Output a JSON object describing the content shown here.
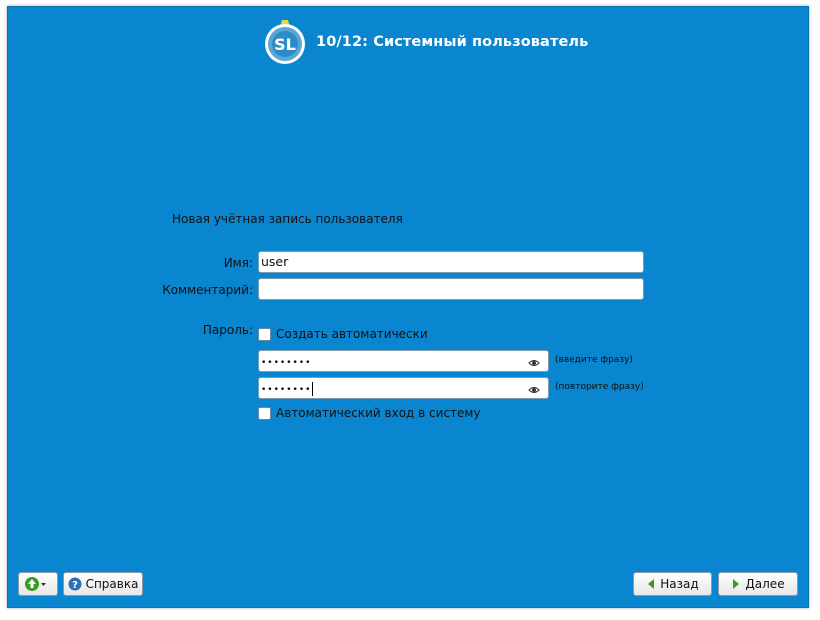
{
  "header": {
    "logo_text": "SL",
    "title": "10/12: Системный пользователь"
  },
  "form": {
    "section_title": "Новая учётная запись пользователя",
    "name_label": "Имя:",
    "name_value": "user",
    "comment_label": "Комментарий:",
    "comment_value": "",
    "password_label": "Пароль:",
    "auto_create_label": "Создать автоматически",
    "auto_create_checked": false,
    "password_value": "••••••••",
    "password_hint": "(введите фразу)",
    "password_repeat_value": "••••••••",
    "password_repeat_hint": "(повторите фразу)",
    "autologin_label": "Автоматический вход в систему",
    "autologin_checked": false
  },
  "footer": {
    "help_label": "Справка",
    "back_label": "Назад",
    "next_label": "Далее"
  },
  "colors": {
    "background": "#0a86d1",
    "icon_green": "#3f9a22"
  }
}
